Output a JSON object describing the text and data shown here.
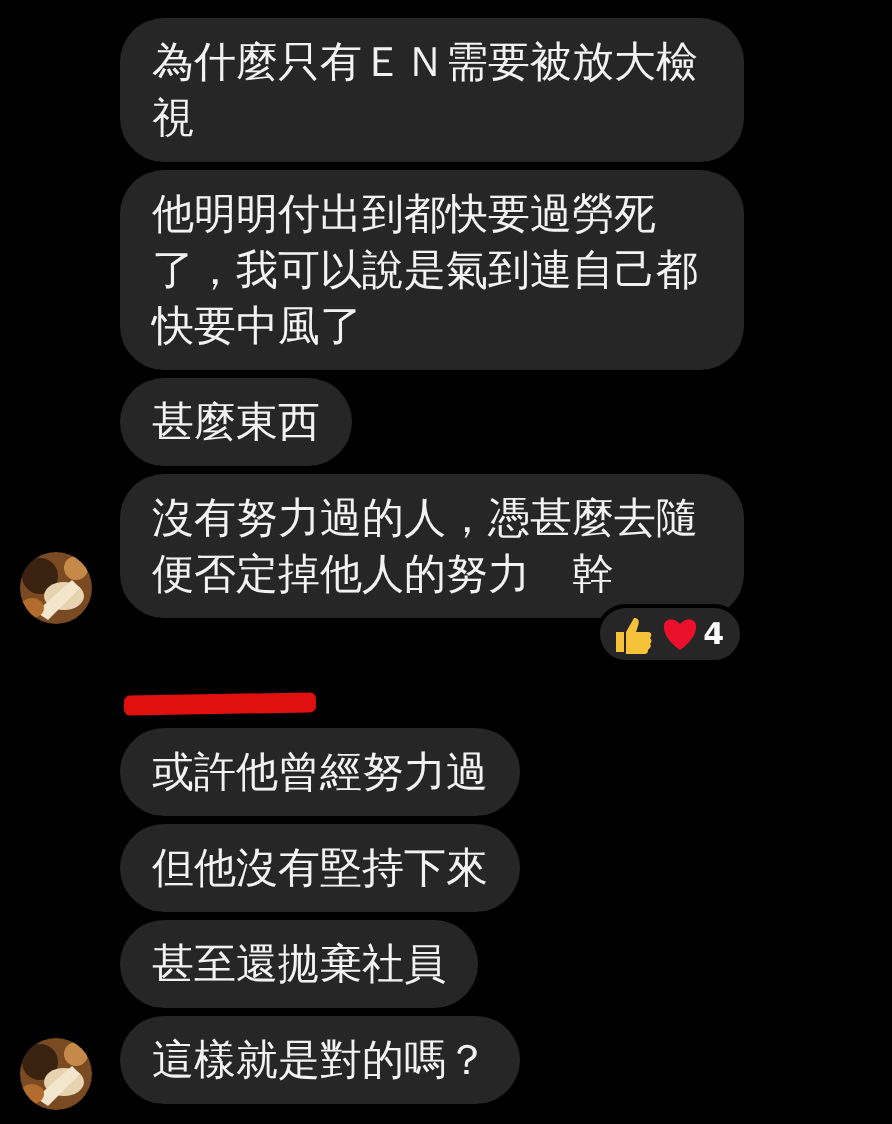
{
  "groups": [
    {
      "name_redacted": false,
      "messages": [
        {
          "text": "為什麼只有ＥＮ需要被放大檢視",
          "avatar": false
        },
        {
          "text": "他明明付出到都快要過勞死了，我可以說是氣到連自己都快要中風了",
          "avatar": false
        },
        {
          "text": "甚麼東西",
          "avatar": false
        },
        {
          "text": "沒有努力過的人，憑甚麼去隨便否定掉他人的努力　幹",
          "avatar": true,
          "reactions": {
            "count": "4"
          }
        }
      ]
    },
    {
      "name_redacted": true,
      "messages": [
        {
          "text": "或許他曾經努力過",
          "avatar": false
        },
        {
          "text": "但他沒有堅持下來",
          "avatar": false
        },
        {
          "text": "甚至還拋棄社員",
          "avatar": false
        },
        {
          "text": "這樣就是對的嗎？",
          "avatar": true
        }
      ]
    }
  ]
}
